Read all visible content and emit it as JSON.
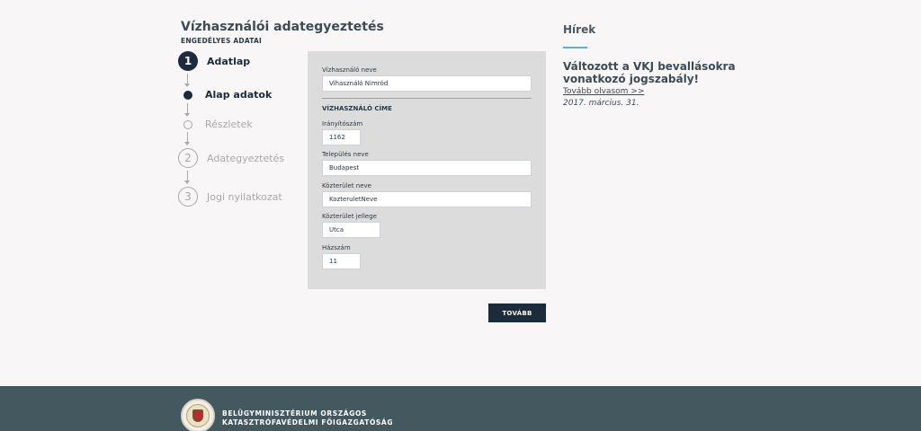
{
  "header": {
    "title": "Vízhasználói adategyeztetés",
    "subtitle": "ENGEDÉLYES ADATAI"
  },
  "steps": [
    {
      "number": "1",
      "label": "Adatlap",
      "state": "active"
    },
    {
      "label": "Alap adatok",
      "state": "current-sub"
    },
    {
      "label": "Részletek",
      "state": "inactive-sub"
    },
    {
      "number": "2",
      "label": "Adategyeztetés",
      "state": "inactive"
    },
    {
      "number": "3",
      "label": "Jogi nyilatkozat",
      "state": "inactive"
    }
  ],
  "form": {
    "user_name_label": "Vízhasználó neve",
    "user_name_value": "Vihasználó Nimród",
    "address_section_title": "VÍZHASZNÁLÓ CÍME",
    "zip_label": "Irányítószám",
    "zip_value": "1162",
    "city_label": "Település neve",
    "city_value": "Budapest",
    "street_label": "Közterület neve",
    "street_value": "KozteruletNeve",
    "street_type_label": "Közterület jellege",
    "street_type_value": "Utca",
    "house_number_label": "Házszám",
    "house_number_value": "11"
  },
  "actions": {
    "next_label": "TOVÁBB"
  },
  "news": {
    "heading": "Hírek",
    "title": "Változott a VKJ bevallásokra vonatkozó jogszabály!",
    "link_label": "Tovább olvasom >>",
    "date": "2017. március. 31."
  },
  "footer": {
    "org_line1": "BELÜGYMINISZTÉRIUM ORSZÁGOS",
    "org_line2": "KATASZTRÓFAVÉDELMI FŐIGAZGATÓSÁG"
  },
  "colors": {
    "primary": "#1c2b3b",
    "accent": "#4fb6d3",
    "footer_bg": "#445860",
    "panel_bg": "#dcdcdc"
  }
}
